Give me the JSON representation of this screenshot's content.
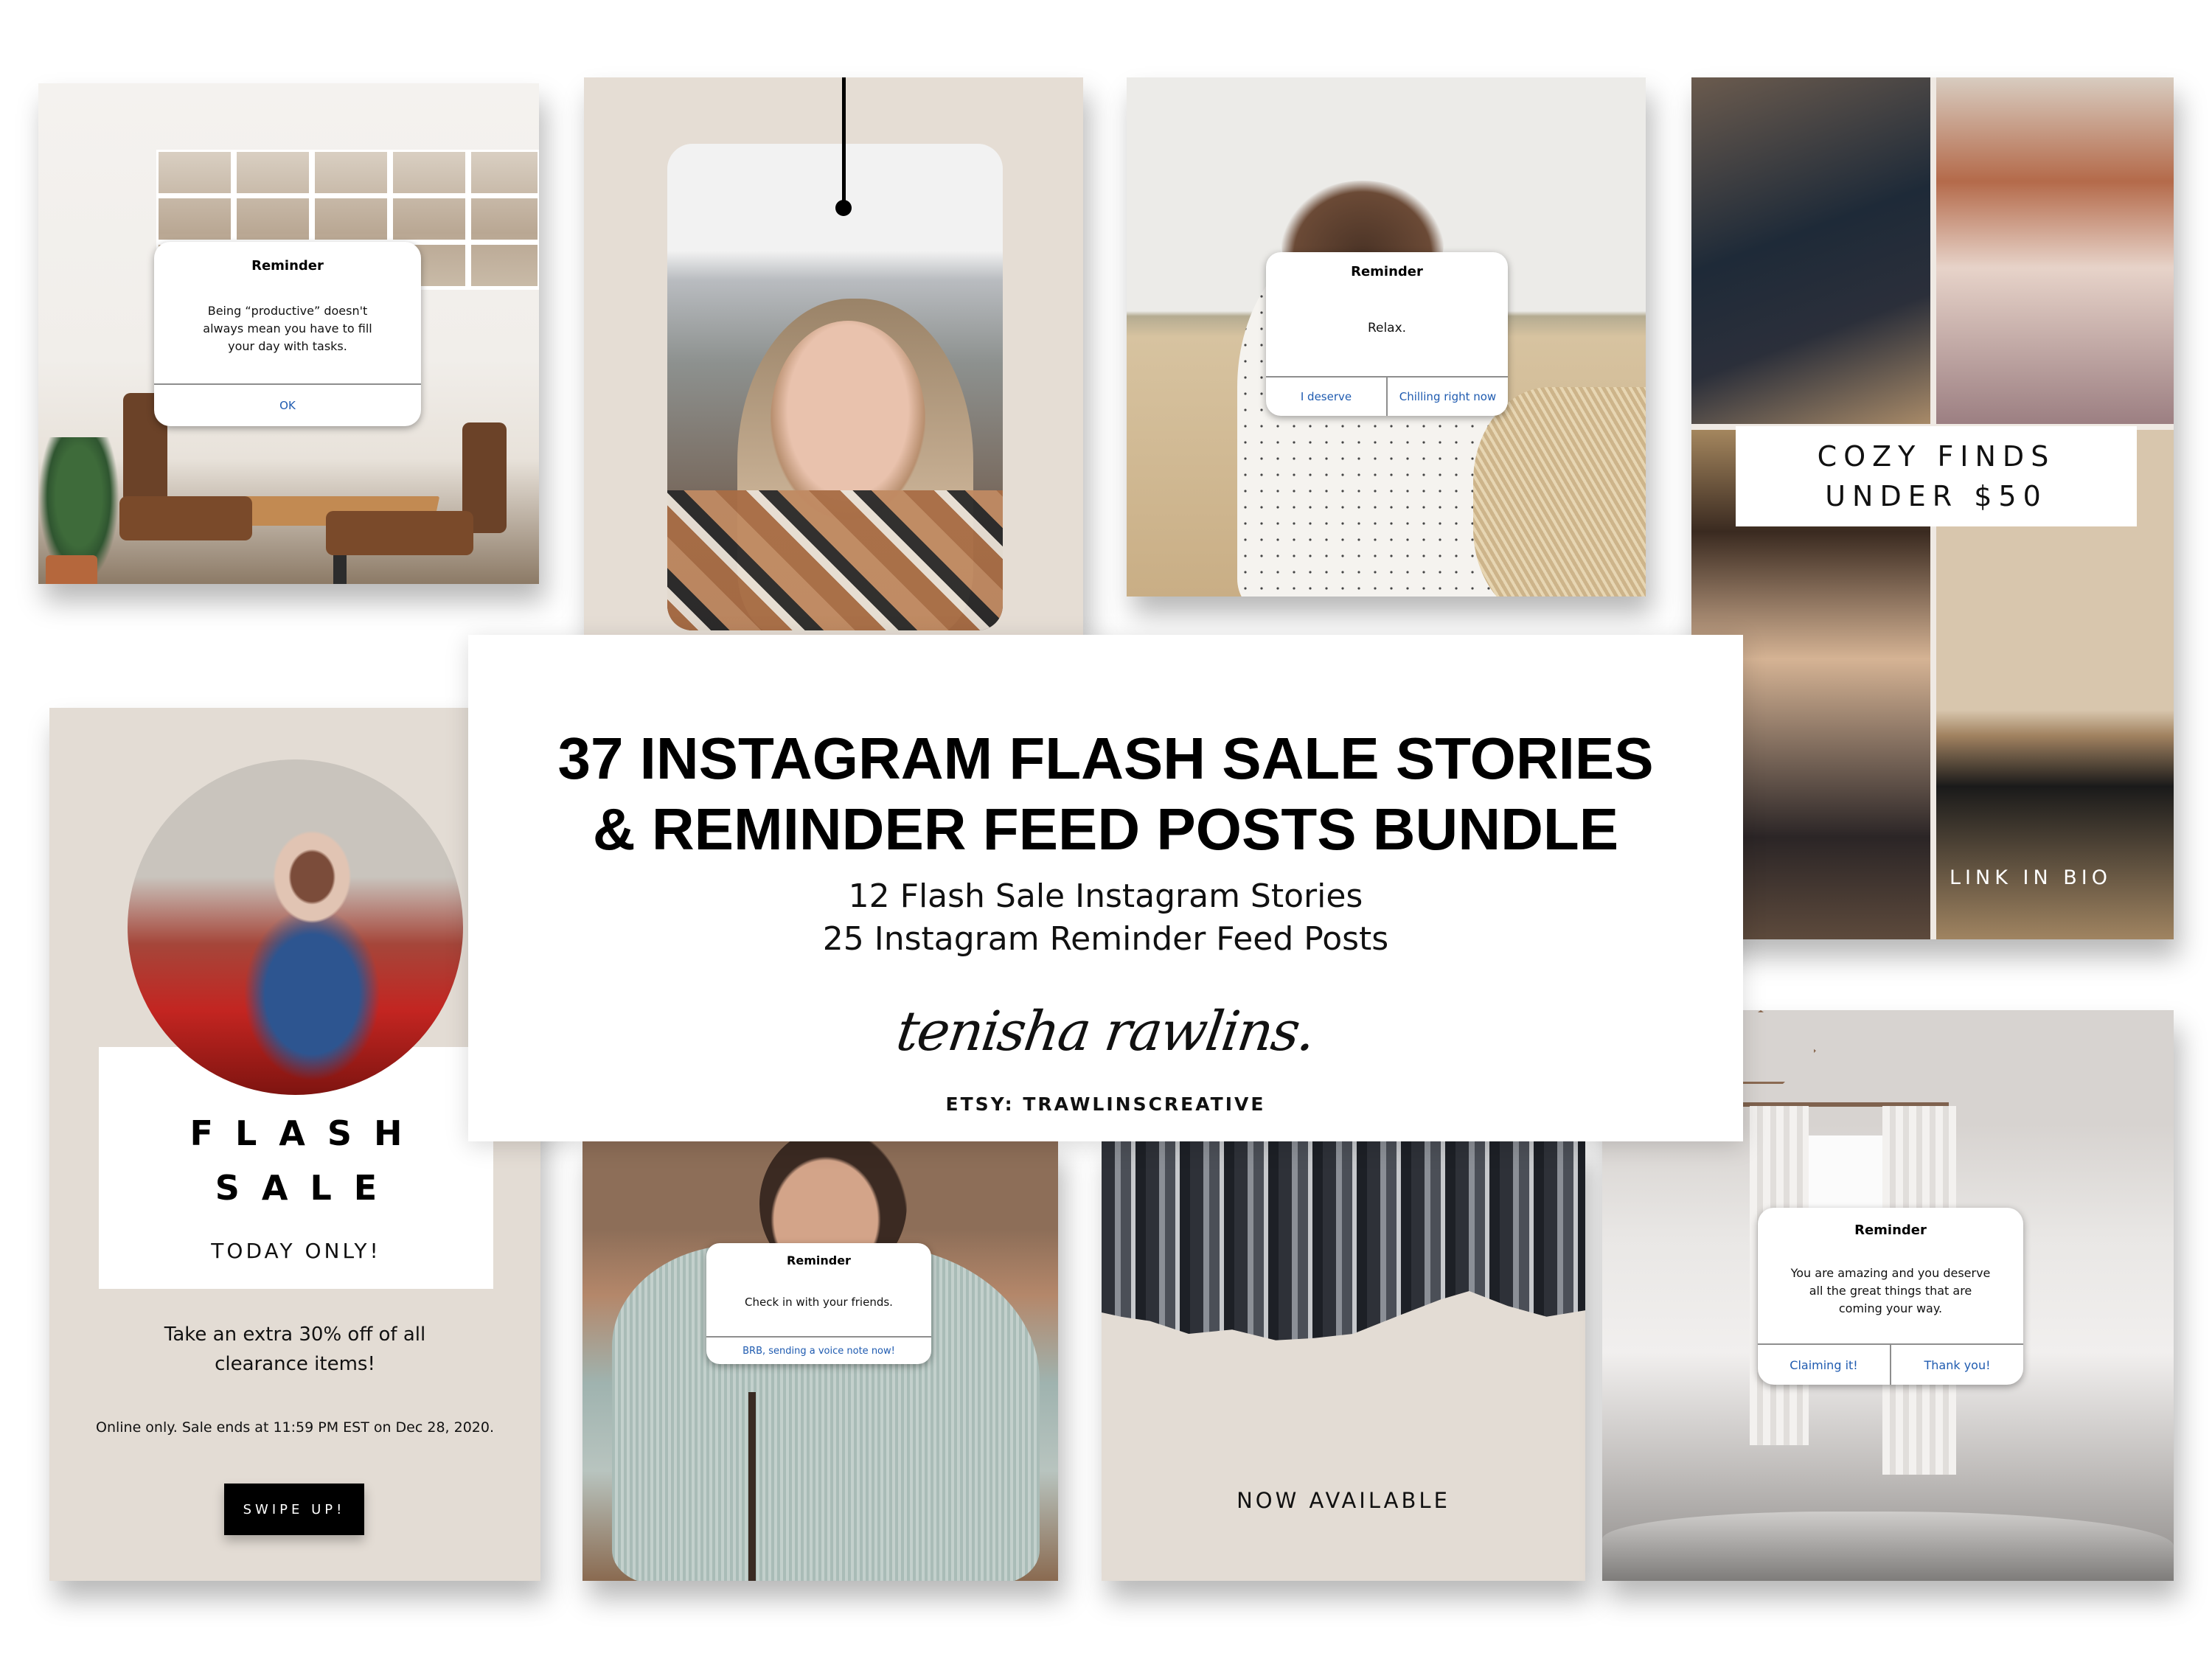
{
  "panels": {
    "cafe_post": {
      "dialog": {
        "title": "Reminder",
        "message": "Being “productive” doesn't always mean you have to fill your day with tasks.",
        "actions": [
          "OK"
        ]
      }
    },
    "tag_story": {
      "description": "hanging tag photo card"
    },
    "field_post": {
      "dialog": {
        "title": "Reminder",
        "message": "Relax.",
        "actions": [
          "I deserve",
          "Chilling right now"
        ]
      }
    },
    "cozy_story": {
      "headline_line1": "COZY FINDS",
      "headline_line2": "UNDER $50",
      "cta": "LINK IN BIO"
    },
    "flash_sale_story": {
      "title_line1": "FLASH",
      "title_line2": "SALE",
      "subtitle": "TODAY ONLY!",
      "offer": "Take an extra 30% off of all clearance items!",
      "fine_print": "Online only. Sale ends at 11:59 PM EST on Dec 28, 2020.",
      "button": "SWIPE UP!"
    },
    "friends_post": {
      "dialog": {
        "title": "Reminder",
        "message": "Check in with your friends.",
        "actions": [
          "BRB, sending a voice note now!"
        ]
      }
    },
    "available_story": {
      "text": "NOW AVAILABLE"
    },
    "bedroom_post": {
      "dialog": {
        "title": "Reminder",
        "message": "You are amazing and you deserve all the great things that are coming your way.",
        "actions": [
          "Claiming it!",
          "Thank you!"
        ]
      }
    }
  },
  "center_card": {
    "title_line1": "37 INSTAGRAM FLASH SALE STORIES",
    "title_line2": "& REMINDER FEED POSTS BUNDLE",
    "sub_line1": "12 Flash Sale Instagram Stories",
    "sub_line2": "25 Instagram Reminder Feed Posts",
    "signature": "tenisha rawlins.",
    "shop": "ETSY: TRAWLINSCREATIVE"
  },
  "colors": {
    "beige": "#e3dcd4",
    "link_blue": "#1f5bb0",
    "black": "#000000"
  }
}
